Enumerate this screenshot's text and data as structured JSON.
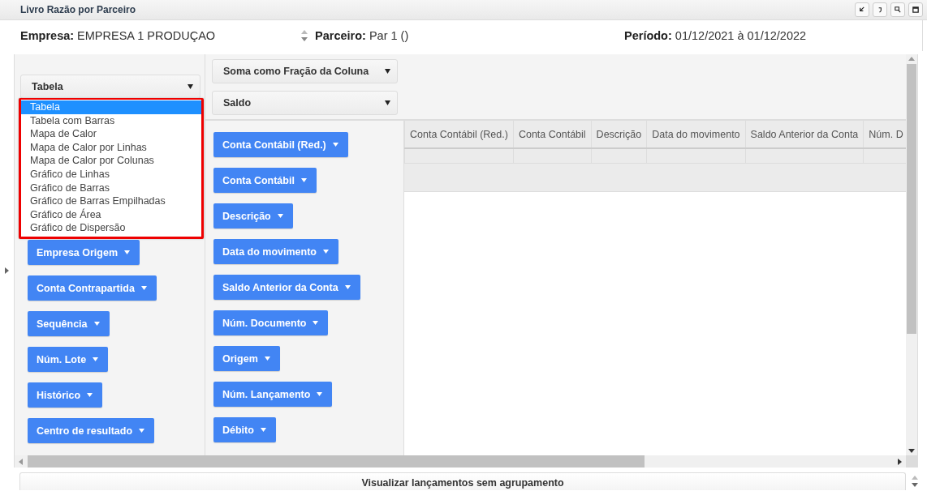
{
  "window": {
    "title": "Livro Razão por Parceiro"
  },
  "filters": [
    {
      "kind": "plain",
      "label": "Empresa:",
      "value": "EMPRESA 1 PRODUÇAO"
    },
    {
      "kind": "spinner",
      "label": "Parceiro:",
      "value": "Par 1 ()"
    },
    {
      "kind": "plain",
      "label": "Período:",
      "value": "01/12/2021 à 01/12/2022"
    }
  ],
  "renderer": {
    "value": "Tabela",
    "expanded": true,
    "options": [
      {
        "label": "Tabela",
        "selected": true
      },
      {
        "label": "Tabela com Barras",
        "selected": false
      },
      {
        "label": "Mapa de Calor",
        "selected": false
      },
      {
        "label": "Mapa de Calor por Linhas",
        "selected": false
      },
      {
        "label": "Mapa de Calor por Colunas",
        "selected": false
      },
      {
        "label": "Gráfico de Linhas",
        "selected": false
      },
      {
        "label": "Gráfico de Barras",
        "selected": false
      },
      {
        "label": "Gráfico de Barras Empilhadas",
        "selected": false
      },
      {
        "label": "Gráfico de Área",
        "selected": false
      },
      {
        "label": "Gráfico de Dispersão",
        "selected": false
      }
    ]
  },
  "aggregator": {
    "value": "Soma como Fração da Coluna"
  },
  "aggregator_attribute": {
    "value": "Saldo"
  },
  "unused_attributes": [
    "Empresa Origem",
    "Conta Contrapartida",
    "Sequência",
    "Núm. Lote",
    "Histórico",
    "Centro de resultado"
  ],
  "row_attributes": [
    "Conta Contábil (Red.)",
    "Conta Contábil",
    "Descrição",
    "Data do movimento",
    "Saldo Anterior da Conta",
    "Núm. Documento",
    "Origem",
    "Núm. Lançamento",
    "Débito"
  ],
  "table": {
    "columns": [
      "Conta Contábil (Red.)",
      "Conta Contábil",
      "Descrição",
      "Data do movimento",
      "Saldo Anterior da Conta",
      "Núm. D"
    ]
  },
  "footer_button": "Visualizar lançamentos sem agrupamento"
}
